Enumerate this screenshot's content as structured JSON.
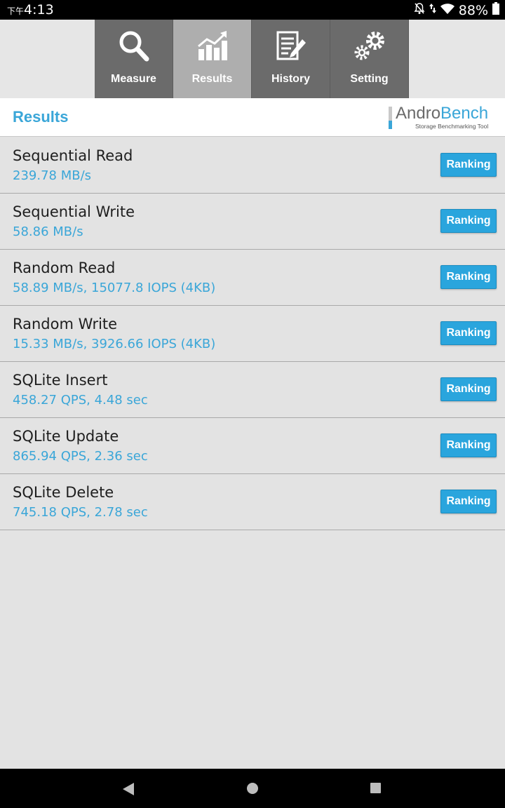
{
  "status_bar": {
    "ampm": "下午",
    "time": "4:13",
    "battery": "88%",
    "icons": [
      "notifications-off-icon",
      "data-arrows-icon",
      "wifi-icon",
      "battery-icon"
    ]
  },
  "tabs": [
    {
      "label": "Measure",
      "icon": "magnifier-icon",
      "active": false
    },
    {
      "label": "Results",
      "icon": "bar-chart-icon",
      "active": true
    },
    {
      "label": "History",
      "icon": "document-pencil-icon",
      "active": false
    },
    {
      "label": "Setting",
      "icon": "gears-icon",
      "active": false
    }
  ],
  "header": {
    "title": "Results",
    "logo": {
      "brand_part1": "Andro",
      "brand_part2": "Bench",
      "tagline": "Storage Benchmarking Tool"
    }
  },
  "results": [
    {
      "name": "Sequential Read",
      "value": "239.78 MB/s",
      "button": "Ranking"
    },
    {
      "name": "Sequential Write",
      "value": "58.86 MB/s",
      "button": "Ranking"
    },
    {
      "name": "Random Read",
      "value": "58.89 MB/s, 15077.8 IOPS (4KB)",
      "button": "Ranking"
    },
    {
      "name": "Random Write",
      "value": "15.33 MB/s, 3926.66 IOPS (4KB)",
      "button": "Ranking"
    },
    {
      "name": "SQLite Insert",
      "value": "458.27 QPS, 4.48 sec",
      "button": "Ranking"
    },
    {
      "name": "SQLite Update",
      "value": "865.94 QPS, 2.36 sec",
      "button": "Ranking"
    },
    {
      "name": "SQLite Delete",
      "value": "745.18 QPS, 2.78 sec",
      "button": "Ranking"
    }
  ],
  "nav_bar": {
    "icons": [
      "back-icon",
      "home-icon",
      "recents-icon"
    ]
  },
  "colors": {
    "accent": "#3aa6d8",
    "button": "#2aa5dd",
    "tab_bg": "#6b6b6b",
    "tab_active_bg": "#aeaeae",
    "background": "#e3e3e3"
  }
}
